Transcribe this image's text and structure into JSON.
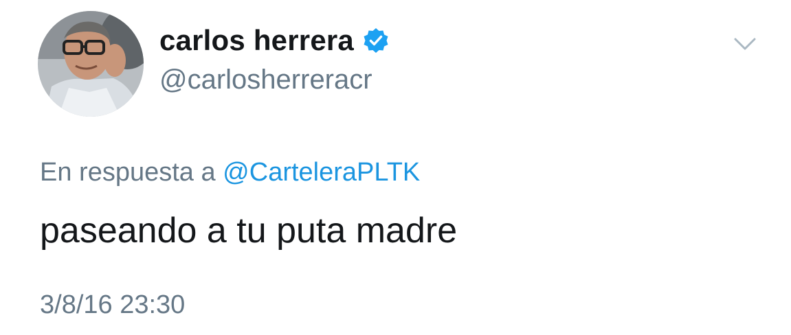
{
  "user": {
    "display_name": "carlos herrera",
    "handle": "@carlosherreracr",
    "verified": true,
    "avatar_icon": "user-avatar-photo"
  },
  "reply": {
    "prefix": "En respuesta a ",
    "to_handle": "@CarteleraPLTK"
  },
  "tweet": {
    "text": "paseando a tu puta madre",
    "timestamp": "3/8/16 23:30"
  },
  "icons": {
    "verified": "verified-badge-icon",
    "menu": "chevron-down-icon"
  },
  "colors": {
    "text_primary": "#14171a",
    "text_secondary": "#657786",
    "link": "#1b95e0",
    "verified": "#1da1f2"
  }
}
